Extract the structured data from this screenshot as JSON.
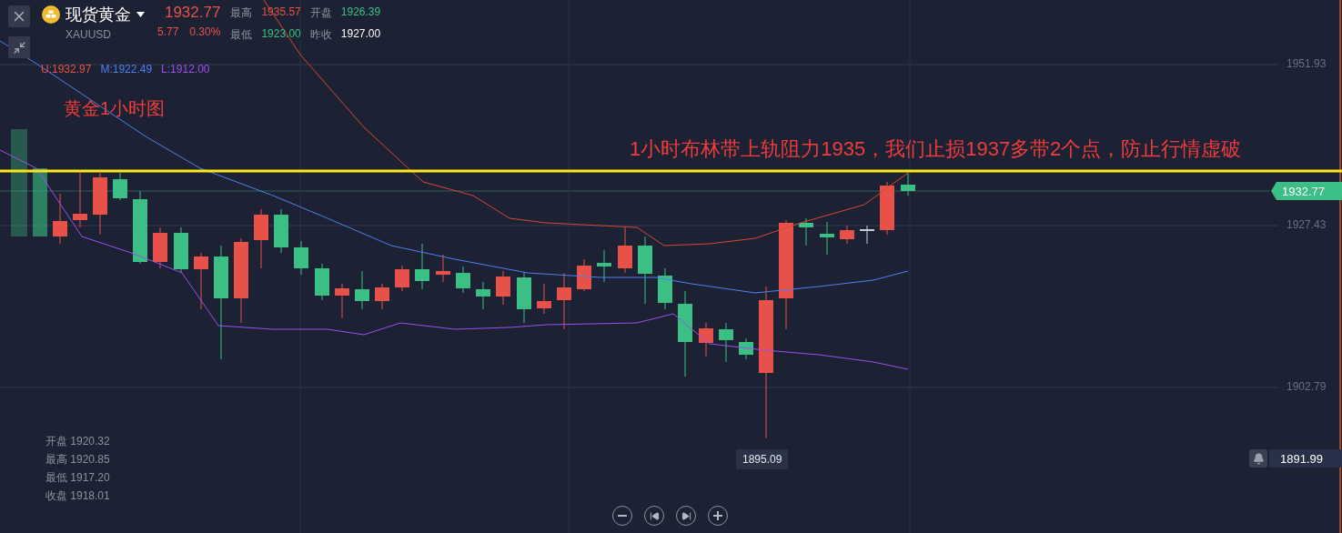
{
  "header": {
    "title": "现货黄金",
    "symbol": "XAUUSD",
    "price": "1932.77",
    "change": "5.77",
    "change_percent": "0.30%",
    "stats": [
      {
        "label": "最高",
        "value": "1935.57",
        "color": "#e8514a"
      },
      {
        "label": "开盘",
        "value": "1926.39",
        "color": "#3bbf84"
      },
      {
        "label": "最低",
        "value": "1923.00",
        "color": "#3bbf84"
      },
      {
        "label": "昨收",
        "value": "1927.00",
        "color": "#ffffff"
      }
    ]
  },
  "bollinger_legend": [
    {
      "text": "U:1932.97",
      "color": "#e8514a"
    },
    {
      "text": "M:1922.49",
      "color": "#4f7ff0"
    },
    {
      "text": "L:1912.00",
      "color": "#9b4ff0"
    }
  ],
  "annotations": [
    {
      "kind": "title",
      "text": "黄金1小时图"
    },
    {
      "kind": "note",
      "text": "1小时布林带上轨阻力1935，我们止损1937多带2个点，防止行情虚破"
    }
  ],
  "price_axis": {
    "labels": [
      "1951.93",
      "1927.43",
      "1902.79"
    ],
    "current_price": "1932.77",
    "alert_price": "1891.99"
  },
  "low_marker": "1895.09",
  "ohlc": [
    {
      "label": "开盘",
      "value": "1920.32"
    },
    {
      "label": "最高",
      "value": "1920.85"
    },
    {
      "label": "最低",
      "value": "1917.20"
    },
    {
      "label": "收盘",
      "value": "1918.01"
    }
  ],
  "zoom_controls": [
    {
      "kind": "zoom-out"
    },
    {
      "kind": "prev"
    },
    {
      "kind": "next"
    },
    {
      "kind": "zoom-in"
    }
  ]
}
